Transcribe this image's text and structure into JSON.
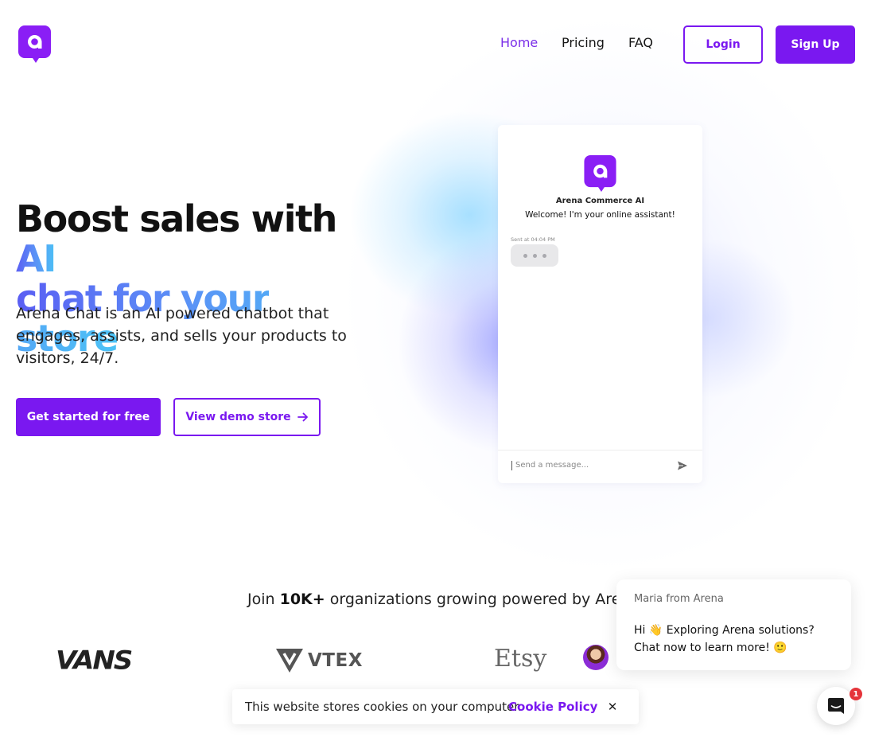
{
  "brand": {
    "logo_icon": "arena-logo-icon",
    "accent": "#7a18f0"
  },
  "nav": {
    "home": "Home",
    "pricing": "Pricing",
    "faq": "FAQ",
    "login": "Login",
    "signup": "Sign Up"
  },
  "hero": {
    "title_plain": "Boost sales with",
    "title_ai": "AI",
    "title_line2": "chat for your store",
    "subtitle": "Arena Chat is an AI powered chatbot that engages, assists, and sells your products to visitors, 24/7.",
    "cta_primary": "Get started for free",
    "cta_secondary": "View demo store"
  },
  "chat_preview": {
    "name": "Arena Commerce AI",
    "welcome": "Welcome! I'm your online assistant!",
    "sent_at": "Sent at 04:04 PM",
    "input_placeholder": "Send a message..."
  },
  "social_proof": {
    "prefix": "Join",
    "count": "10K+",
    "suffix": "organizations growing powered by Arena",
    "brands": [
      "VANS",
      "VTEX",
      "Etsy"
    ]
  },
  "messenger": {
    "from": "Maria from Arena",
    "message": "Hi 👋 Exploring Arena solutions? Chat now to learn more! 🙂",
    "unread": "1"
  },
  "cookie": {
    "text": "This website stores cookies on your computer.",
    "link": "Cookie Policy",
    "close": "✕"
  }
}
